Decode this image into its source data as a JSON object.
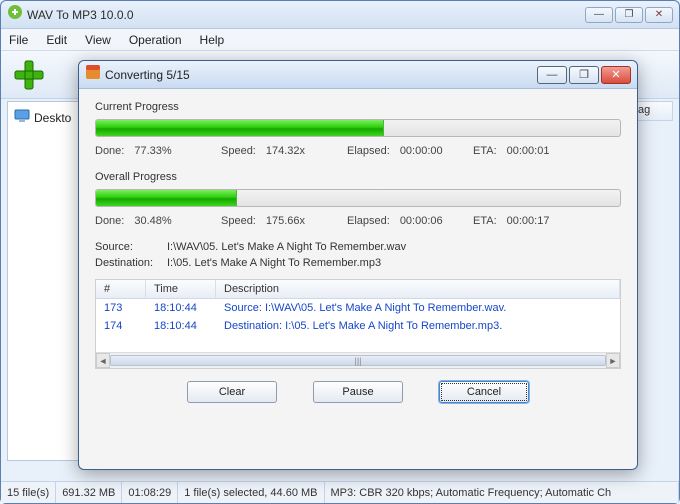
{
  "app": {
    "title": "WAV To MP3 10.0.0"
  },
  "menu": {
    "file": "File",
    "edit": "Edit",
    "view": "View",
    "operation": "Operation",
    "help": "Help"
  },
  "tree": {
    "desktop": "Deskto"
  },
  "list_header_tag": "ag",
  "status": {
    "count": "15 file(s)",
    "size": "691.32 MB",
    "duration": "01:08:29",
    "selected": "1 file(s) selected, 44.60 MB",
    "mp3": "MP3:  CBR 320 kbps; Automatic Frequency; Automatic Ch"
  },
  "dialog": {
    "title": "Converting 5/15",
    "current": {
      "label": "Current Progress",
      "percent": 55,
      "done_label": "Done:",
      "done": "77.33%",
      "speed_label": "Speed:",
      "speed": "174.32x",
      "elapsed_label": "Elapsed:",
      "elapsed": "00:00:00",
      "eta_label": "ETA:",
      "eta": "00:00:01"
    },
    "overall": {
      "label": "Overall Progress",
      "percent": 27,
      "done_label": "Done:",
      "done": "30.48%",
      "speed_label": "Speed:",
      "speed": "175.66x",
      "elapsed_label": "Elapsed:",
      "elapsed": "00:00:06",
      "eta_label": "ETA:",
      "eta": "00:00:17"
    },
    "source_label": "Source:",
    "source": "I:\\WAV\\05. Let's Make A Night To Remember.wav",
    "dest_label": "Destination:",
    "dest": "I:\\05. Let's Make A Night To Remember.mp3",
    "log": {
      "headers": {
        "n": "#",
        "time": "Time",
        "desc": "Description"
      },
      "rows": [
        {
          "n": "173",
          "time": "18:10:44",
          "desc": "Source:  I:\\WAV\\05. Let's Make A Night To Remember.wav."
        },
        {
          "n": "174",
          "time": "18:10:44",
          "desc": "Destination: I:\\05. Let's Make A Night To Remember.mp3."
        }
      ]
    },
    "buttons": {
      "clear": "Clear",
      "pause": "Pause",
      "cancel": "Cancel"
    }
  }
}
